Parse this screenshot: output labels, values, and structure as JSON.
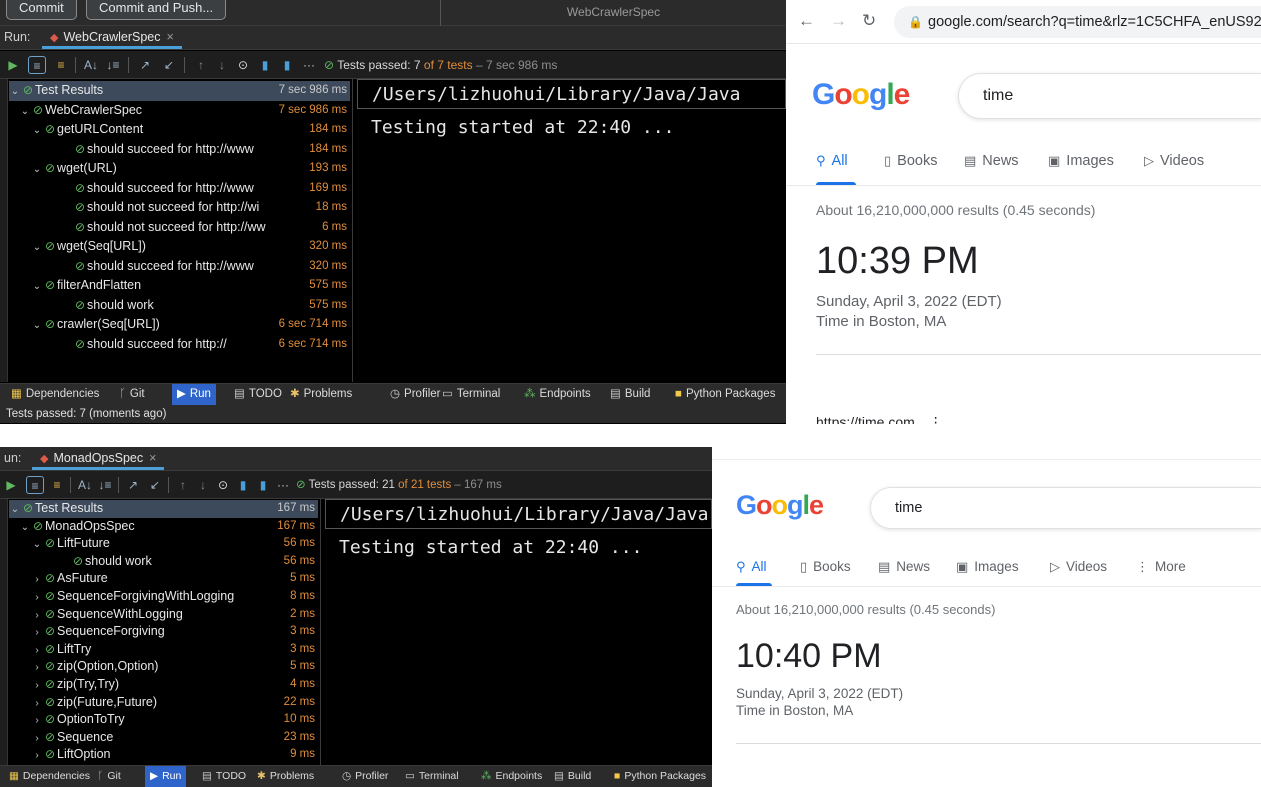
{
  "top_ide": {
    "commit_button": "Commit",
    "commit_push_button": "Commit and Push...",
    "header_title": "WebCrawlerSpec",
    "run_label": "Run:",
    "run_tab": "WebCrawlerSpec",
    "tests_passed_prefix": "Tests passed: 7",
    "tests_passed_of": "of 7 tests",
    "tests_passed_time": "– 7 sec 986 ms",
    "tree": [
      {
        "label": "Test Results",
        "dur": "7 sec 986 ms",
        "level": 0,
        "chev": "down",
        "hl": true
      },
      {
        "label": "WebCrawlerSpec",
        "dur": "7 sec 986 ms",
        "level": 1,
        "chev": "down"
      },
      {
        "label": "getURLContent",
        "dur": "184 ms",
        "level": 2,
        "chev": "down"
      },
      {
        "label": "should succeed for http://www",
        "dur": "184 ms",
        "level": 3,
        "chev": "none"
      },
      {
        "label": "wget(URL)",
        "dur": "193 ms",
        "level": 2,
        "chev": "down"
      },
      {
        "label": "should succeed for http://www",
        "dur": "169 ms",
        "level": 3,
        "chev": "none"
      },
      {
        "label": "should not succeed for http://wi",
        "dur": "18 ms",
        "level": 3,
        "chev": "none"
      },
      {
        "label": "should not succeed for http://ww",
        "dur": "6 ms",
        "level": 3,
        "chev": "none"
      },
      {
        "label": "wget(Seq[URL])",
        "dur": "320 ms",
        "level": 2,
        "chev": "down"
      },
      {
        "label": "should succeed for http://www",
        "dur": "320 ms",
        "level": 3,
        "chev": "none"
      },
      {
        "label": "filterAndFlatten",
        "dur": "575 ms",
        "level": 2,
        "chev": "down"
      },
      {
        "label": "should work",
        "dur": "575 ms",
        "level": 3,
        "chev": "none"
      },
      {
        "label": "crawler(Seq[URL])",
        "dur": "6 sec 714 ms",
        "level": 2,
        "chev": "down"
      },
      {
        "label": "should succeed for http://",
        "dur": "6 sec 714 ms",
        "level": 3,
        "chev": "none"
      }
    ],
    "console_path": "/Users/lizhuohui/Library/Java/Java",
    "console_line": "Testing started at 22:40 ...",
    "bottom_tools": [
      "Dependencies",
      "Git",
      "Run",
      "TODO",
      "Problems",
      "Profiler",
      "Terminal",
      "Endpoints",
      "Build",
      "Python Packages"
    ],
    "status": "Tests passed: 7 (moments ago)"
  },
  "bottom_ide": {
    "run_label": "un:",
    "run_tab": "MonadOpsSpec",
    "tests_passed_prefix": "Tests passed: 21",
    "tests_passed_of": "of 21 tests",
    "tests_passed_time": "– 167 ms",
    "tree": [
      {
        "label": "Test Results",
        "dur": "167 ms",
        "level": 0,
        "chev": "down",
        "hl": true
      },
      {
        "label": "MonadOpsSpec",
        "dur": "167 ms",
        "level": 1,
        "chev": "down"
      },
      {
        "label": "LiftFuture",
        "dur": "56 ms",
        "level": 2,
        "chev": "down"
      },
      {
        "label": "should work",
        "dur": "56 ms",
        "level": 3,
        "chev": "none"
      },
      {
        "label": "AsFuture",
        "dur": "5 ms",
        "level": 2,
        "chev": "right"
      },
      {
        "label": "SequenceForgivingWithLogging",
        "dur": "8 ms",
        "level": 2,
        "chev": "right"
      },
      {
        "label": "SequenceWithLogging",
        "dur": "2 ms",
        "level": 2,
        "chev": "right"
      },
      {
        "label": "SequenceForgiving",
        "dur": "3 ms",
        "level": 2,
        "chev": "right"
      },
      {
        "label": "LiftTry",
        "dur": "3 ms",
        "level": 2,
        "chev": "right"
      },
      {
        "label": "zip(Option,Option)",
        "dur": "5 ms",
        "level": 2,
        "chev": "right"
      },
      {
        "label": "zip(Try,Try)",
        "dur": "4 ms",
        "level": 2,
        "chev": "right"
      },
      {
        "label": "zip(Future,Future)",
        "dur": "22 ms",
        "level": 2,
        "chev": "right"
      },
      {
        "label": "OptionToTry",
        "dur": "10 ms",
        "level": 2,
        "chev": "right"
      },
      {
        "label": "Sequence",
        "dur": "23 ms",
        "level": 2,
        "chev": "right"
      },
      {
        "label": "LiftOption",
        "dur": "9 ms",
        "level": 2,
        "chev": "right"
      }
    ],
    "console_path": "/Users/lizhuohui/Library/Java/Java",
    "console_line": "Testing started at 22:40 ...",
    "bottom_tools": [
      "Dependencies",
      "Git",
      "Run",
      "TODO",
      "Problems",
      "Profiler",
      "Terminal",
      "Endpoints",
      "Build",
      "Python Packages"
    ]
  },
  "top_browser": {
    "url": "google.com/search?q=time&rlz=1C5CHFA_enUS92",
    "query": "time",
    "tabs": [
      "All",
      "Books",
      "News",
      "Images",
      "Videos"
    ],
    "stats": "About 16,210,000,000 results (0.45 seconds)",
    "time": "10:39 PM",
    "date": "Sunday, April 3, 2022 (EDT)",
    "location": "Time in Boston, MA",
    "peek_link": "https://time.com"
  },
  "bottom_browser": {
    "query": "time",
    "tabs": [
      "All",
      "Books",
      "News",
      "Images",
      "Videos",
      "More"
    ],
    "stats": "About 16,210,000,000 results (0.45 seconds)",
    "time": "10:40 PM",
    "date": "Sunday, April 3, 2022 (EDT)",
    "location": "Time in Boston, MA"
  },
  "colors": {
    "ide_bg": "#000000",
    "duration": "#e08d3c",
    "passed_green": "#62b861",
    "run_active": "#2f65ca",
    "google_blue": "#1a73e8"
  }
}
